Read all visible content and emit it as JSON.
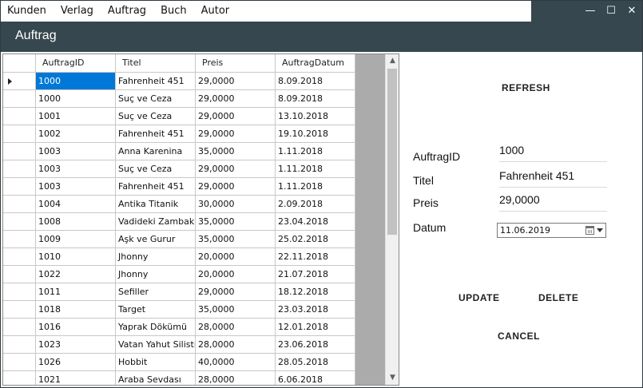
{
  "menu": {
    "items": [
      "Kunden",
      "Verlag",
      "Auftrag",
      "Buch",
      "Autor"
    ]
  },
  "window_controls": {
    "minimize": "—",
    "maximize": "☐",
    "close": "✕"
  },
  "header": {
    "title": "Auftrag"
  },
  "grid": {
    "columns": [
      "AuftragID",
      "Titel",
      "Preis",
      "AuftragDatum"
    ],
    "selected_row": 0,
    "rows": [
      [
        "1000",
        "Fahrenheit 451",
        "29,0000",
        "8.09.2018"
      ],
      [
        "1000",
        "Suç ve Ceza",
        "29,0000",
        "8.09.2018"
      ],
      [
        "1001",
        "Suç ve Ceza",
        "29,0000",
        "13.10.2018"
      ],
      [
        "1002",
        "Fahrenheit 451",
        "29,0000",
        "19.10.2018"
      ],
      [
        "1003",
        "Anna Karenina",
        "35,0000",
        "1.11.2018"
      ],
      [
        "1003",
        "Suç ve Ceza",
        "29,0000",
        "1.11.2018"
      ],
      [
        "1003",
        "Fahrenheit 451",
        "29,0000",
        "1.11.2018"
      ],
      [
        "1004",
        "Antika Titanik",
        "30,0000",
        "2.09.2018"
      ],
      [
        "1008",
        "Vadideki Zambak",
        "35,0000",
        "23.04.2018"
      ],
      [
        "1009",
        "Aşk ve Gurur",
        "35,0000",
        "25.02.2018"
      ],
      [
        "1010",
        "Jhonny",
        "20,0000",
        "22.11.2018"
      ],
      [
        "1022",
        "Jhonny",
        "20,0000",
        "21.07.2018"
      ],
      [
        "1011",
        "Sefiller",
        "29,0000",
        "18.12.2018"
      ],
      [
        "1018",
        "Target",
        "35,0000",
        "23.03.2018"
      ],
      [
        "1016",
        "Yaprak Dökümü",
        "28,0000",
        "12.01.2018"
      ],
      [
        "1023",
        "Vatan Yahut Silistre",
        "28,0000",
        "23.06.2018"
      ],
      [
        "1026",
        "Hobbit",
        "40,0000",
        "28.05.2018"
      ],
      [
        "1021",
        "Araba Sevdası",
        "28,0000",
        "6.06.2018"
      ]
    ]
  },
  "form": {
    "refresh_label": "REFRESH",
    "auftragid_label": "AuftragID",
    "auftragid_value": "1000",
    "titel_label": "Titel",
    "titel_value": "Fahrenheit 451",
    "preis_label": "Preis",
    "preis_value": "29,0000",
    "datum_label": "Datum",
    "datum_value": "11.06.2019",
    "update_label": "UPDATE",
    "delete_label": "DELETE",
    "cancel_label": "CANCEL"
  },
  "colors": {
    "header_bg": "#37474f",
    "selection": "#0078d7"
  }
}
